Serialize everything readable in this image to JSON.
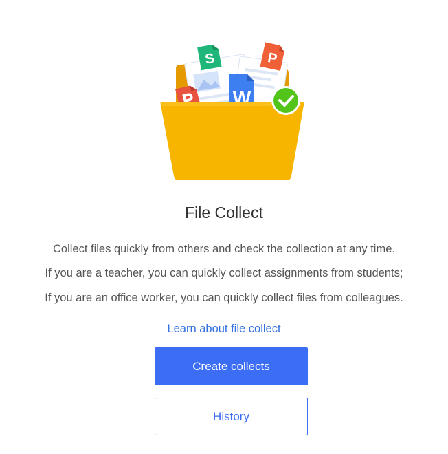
{
  "illustration": {
    "icon": "folder-collect-icon",
    "colors": {
      "folder": "#f7b500",
      "check": "#52c41a",
      "word": "#3d7ef0",
      "pdf": "#e9523f",
      "presentation": "#f06038",
      "sheet": "#1fb67a"
    },
    "file_letters": {
      "word": "W",
      "sheet": "S",
      "presentation": "P"
    }
  },
  "title": "File Collect",
  "description": [
    "Collect files quickly from others and check the collection at any time.",
    "If you are a teacher, you can quickly collect assignments from students;",
    "If you are an office worker, you can quickly collect files from colleagues."
  ],
  "learn_link": "Learn about file collect",
  "buttons": {
    "create": "Create collects",
    "history": "History"
  },
  "accent_color": "#3b6ef5"
}
